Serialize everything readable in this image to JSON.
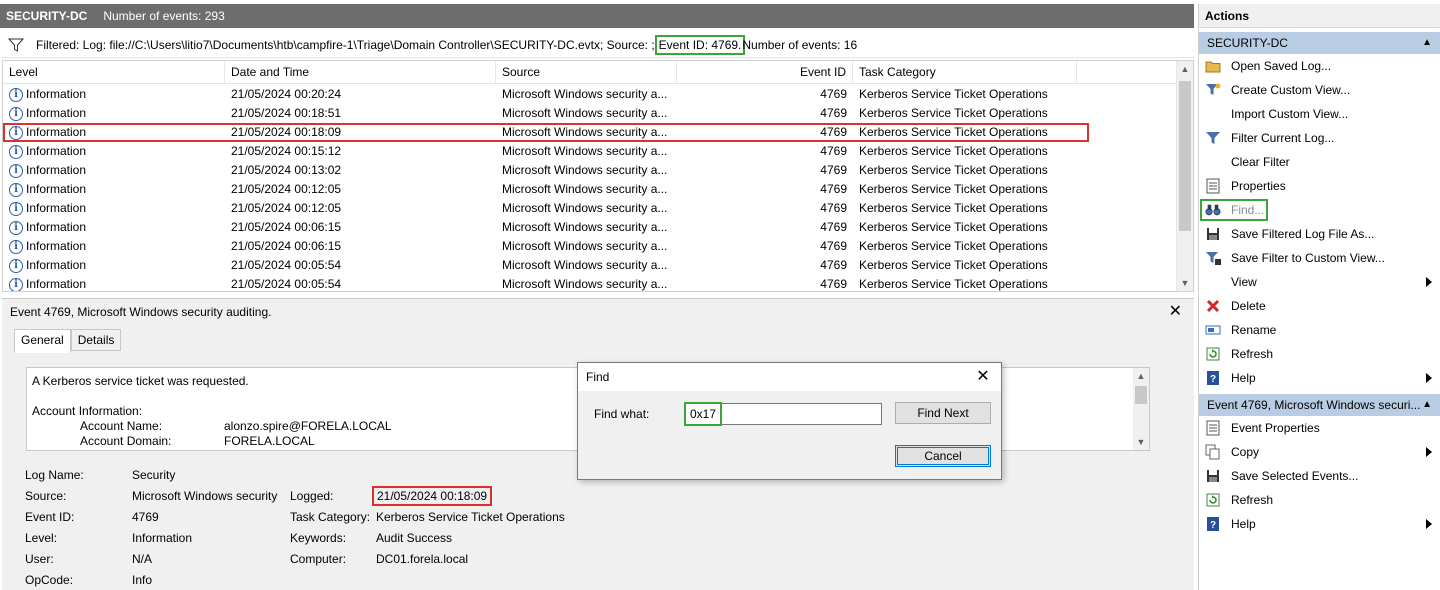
{
  "log": {
    "name": "SECURITY-DC",
    "count_label": "Number of events: 293"
  },
  "filter": {
    "prefix": "Filtered: Log: file://C:\\Users\\litio7\\Documents\\htb\\campfire-1\\Triage\\Domain Controller\\SECURITY-DC.evtx; Source: ;",
    "event_id": "Event ID: 4769.",
    "suffix": "Number of events: 16"
  },
  "grid": {
    "columns": [
      "Level",
      "Date and Time",
      "Source",
      "Event ID",
      "Task Category"
    ],
    "rows": [
      {
        "level": "Information",
        "date": "21/05/2024 00:20:24",
        "source": "Microsoft Windows security a...",
        "id": "4769",
        "task": "Kerberos Service Ticket Operations"
      },
      {
        "level": "Information",
        "date": "21/05/2024 00:18:51",
        "source": "Microsoft Windows security a...",
        "id": "4769",
        "task": "Kerberos Service Ticket Operations"
      },
      {
        "level": "Information",
        "date": "21/05/2024 00:18:09",
        "source": "Microsoft Windows security a...",
        "id": "4769",
        "task": "Kerberos Service Ticket Operations"
      },
      {
        "level": "Information",
        "date": "21/05/2024 00:15:12",
        "source": "Microsoft Windows security a...",
        "id": "4769",
        "task": "Kerberos Service Ticket Operations"
      },
      {
        "level": "Information",
        "date": "21/05/2024 00:13:02",
        "source": "Microsoft Windows security a...",
        "id": "4769",
        "task": "Kerberos Service Ticket Operations"
      },
      {
        "level": "Information",
        "date": "21/05/2024 00:12:05",
        "source": "Microsoft Windows security a...",
        "id": "4769",
        "task": "Kerberos Service Ticket Operations"
      },
      {
        "level": "Information",
        "date": "21/05/2024 00:12:05",
        "source": "Microsoft Windows security a...",
        "id": "4769",
        "task": "Kerberos Service Ticket Operations"
      },
      {
        "level": "Information",
        "date": "21/05/2024 00:06:15",
        "source": "Microsoft Windows security a...",
        "id": "4769",
        "task": "Kerberos Service Ticket Operations"
      },
      {
        "level": "Information",
        "date": "21/05/2024 00:06:15",
        "source": "Microsoft Windows security a...",
        "id": "4769",
        "task": "Kerberos Service Ticket Operations"
      },
      {
        "level": "Information",
        "date": "21/05/2024 00:05:54",
        "source": "Microsoft Windows security a...",
        "id": "4769",
        "task": "Kerberos Service Ticket Operations"
      },
      {
        "level": "Information",
        "date": "21/05/2024 00:05:54",
        "source": "Microsoft Windows security a...",
        "id": "4769",
        "task": "Kerberos Service Ticket Operations"
      }
    ]
  },
  "details": {
    "title": "Event 4769, Microsoft Windows security auditing.",
    "close": "✕",
    "tabs": [
      "General",
      "Details"
    ],
    "description": {
      "line1": "A Kerberos service ticket was requested.",
      "section": "Account Information:",
      "account_name_label": "Account Name:",
      "account_name": "alonzo.spire@FORELA.LOCAL",
      "account_domain_label": "Account Domain:",
      "account_domain": "FORELA.LOCAL"
    },
    "props": {
      "log_name_label": "Log Name:",
      "log_name": "Security",
      "source_label": "Source:",
      "source": "Microsoft Windows security",
      "logged_label": "Logged:",
      "logged": "21/05/2024 00:18:09",
      "event_id_label": "Event ID:",
      "event_id": "4769",
      "task_label": "Task Category:",
      "task": "Kerberos Service Ticket Operations",
      "level_label": "Level:",
      "level": "Information",
      "keywords_label": "Keywords:",
      "keywords": "Audit Success",
      "user_label": "User:",
      "user": "N/A",
      "computer_label": "Computer:",
      "computer": "DC01.forela.local",
      "opcode_label": "OpCode:",
      "opcode": "Info"
    }
  },
  "actions": {
    "title": "Actions",
    "section1": "SECURITY-DC",
    "items1": [
      {
        "label": "Open Saved Log...",
        "icon": "folder-icon"
      },
      {
        "label": "Create Custom View...",
        "icon": "funnel-star-icon"
      },
      {
        "label": "Import Custom View...",
        "icon": ""
      },
      {
        "label": "Filter Current Log...",
        "icon": "funnel-icon"
      },
      {
        "label": "Clear Filter",
        "icon": ""
      },
      {
        "label": "Properties",
        "icon": "properties-icon"
      },
      {
        "label": "Find...",
        "icon": "binoculars-icon"
      },
      {
        "label": "Save Filtered Log File As...",
        "icon": "save-icon"
      },
      {
        "label": "Save Filter to Custom View...",
        "icon": "funnel-save-icon"
      },
      {
        "label": "View",
        "icon": ""
      },
      {
        "label": "Delete",
        "icon": "delete-icon"
      },
      {
        "label": "Rename",
        "icon": "rename-icon"
      },
      {
        "label": "Refresh",
        "icon": "refresh-icon"
      },
      {
        "label": "Help",
        "icon": "help-icon"
      }
    ],
    "section2": "Event 4769, Microsoft Windows securi...",
    "items2": [
      {
        "label": "Event Properties",
        "icon": "properties-icon"
      },
      {
        "label": "Copy",
        "icon": "copy-icon"
      },
      {
        "label": "Save Selected Events...",
        "icon": "save-icon"
      },
      {
        "label": "Refresh",
        "icon": "refresh-icon"
      },
      {
        "label": "Help",
        "icon": "help-icon"
      }
    ]
  },
  "find_dialog": {
    "title": "Find",
    "close": "✕",
    "label": "Find what:",
    "value": "0x17",
    "find_next": "Find Next",
    "cancel": "Cancel"
  },
  "colors": {
    "highlight_green": "#3aa53a",
    "highlight_red": "#d9342b",
    "section_header": "#b8cde4",
    "log_header": "#6d6d6d"
  }
}
